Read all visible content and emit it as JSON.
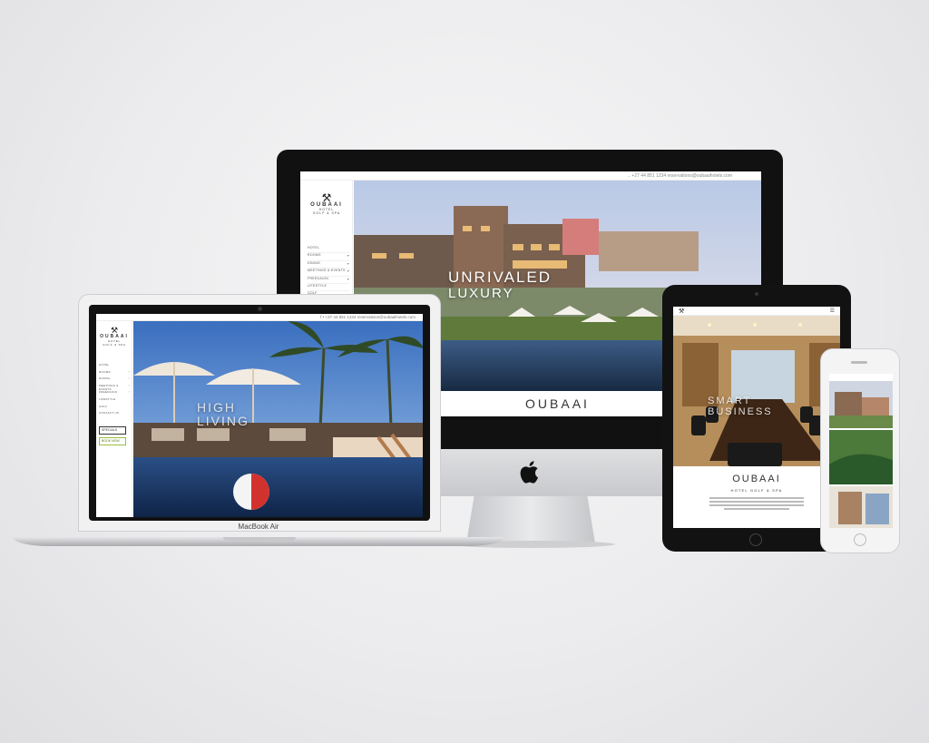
{
  "imac": {
    "topbar": "→ +27 44 851 1234   reservations@oubaaihotels.com",
    "logo": {
      "mark": "⚒",
      "name": "OUBAAI",
      "sub1": "HOTEL",
      "sub2": "GOLF & SPA"
    },
    "nav": [
      {
        "label": "HOTEL",
        "caret": ""
      },
      {
        "label": "ROOMS",
        "caret": "▾"
      },
      {
        "label": "DINING",
        "caret": "▾"
      },
      {
        "label": "MEETINGS & EVENTS",
        "caret": "▾"
      },
      {
        "label": "FREEDAIGN",
        "caret": "▾"
      },
      {
        "label": "LIFESTYLE",
        "caret": ""
      },
      {
        "label": "GOLF",
        "caret": ""
      },
      {
        "label": "CONTACT US",
        "caret": ""
      }
    ],
    "specials_label": "SPECIALS",
    "hero_line1": "UNRIVALED",
    "hero_line2": "LUXURY",
    "footer_brand": "OUBAAI"
  },
  "macbook": {
    "topbar": "f  •  +27 44 851 1234   reservations@oubaaihotels.com",
    "logo": {
      "mark": "⚒",
      "name": "OUBAAI",
      "sub1": "HOTEL",
      "sub2": "GOLF & SPA"
    },
    "nav": [
      {
        "label": "HOTEL",
        "caret": ""
      },
      {
        "label": "ROOMS",
        "caret": "›"
      },
      {
        "label": "DINING",
        "caret": "›"
      },
      {
        "label": "MEETINGS & EVENTS",
        "caret": "›"
      },
      {
        "label": "FREEDAIGN",
        "caret": "›"
      },
      {
        "label": "LIFESTYLE",
        "caret": ""
      },
      {
        "label": "GOLF",
        "caret": ""
      },
      {
        "label": "CONTACT US",
        "caret": ""
      }
    ],
    "specials_label": "SPECIALS",
    "second_label": "BOOK NOW",
    "hero_line1": "HIGH",
    "hero_line2": "LIVING",
    "device_label": "MacBook Air"
  },
  "ipad": {
    "hero_line1": "SMART",
    "hero_line2": "BUSINESS",
    "brand": "OUBAAI",
    "sub": "HOTEL GOLF & SPA"
  },
  "colors": {
    "accent_green": "#9bbf3c",
    "brand_dark": "#333333"
  }
}
